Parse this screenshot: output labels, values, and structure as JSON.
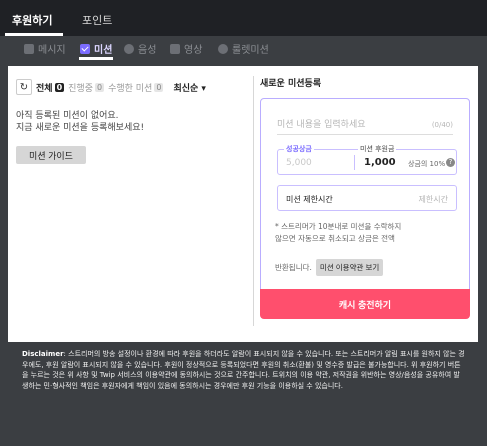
{
  "top_tabs": [
    {
      "label": "후원하기"
    },
    {
      "label": "포인트"
    }
  ],
  "sub_tabs": [
    {
      "label": "메시지",
      "icon": "message-icon"
    },
    {
      "label": "미션",
      "icon": "check-icon"
    },
    {
      "label": "음성",
      "icon": "voice-icon"
    },
    {
      "label": "영상",
      "icon": "video-icon"
    },
    {
      "label": "룰렛미션",
      "icon": "roulette-icon"
    }
  ],
  "left": {
    "filters": [
      {
        "label": "전체",
        "count": "0"
      },
      {
        "label": "진행중",
        "count": "0"
      },
      {
        "label": "수행한 미션",
        "count": "0"
      }
    ],
    "sort_label": "최신순",
    "empty_line1": "아직 등록된 미션이 없어요.",
    "empty_line2": "지금 새로운 미션을 등록해보세요!",
    "guide_button": "미션 가이드"
  },
  "right": {
    "title": "새로운 미션등록",
    "mission_placeholder": "미션 내용을 입력하세요",
    "char_count": "(0/40)",
    "success_label": "성공상금",
    "success_value": "5,000",
    "fee_label": "미션 후원금",
    "fee_value": "1,000",
    "fee_pct": "상금의 10%",
    "limit_label": "미션 제한시간",
    "limit_placeholder": "제한시간",
    "note_line1": "* 스트리머가 10분내로 미션을 수락하지",
    "note_line2": "않으면 자동으로 취소되고 상금은 전액",
    "refund_text": "반환됩니다.",
    "terms_button": "미션 이용약관 보기",
    "charge_button": "캐시 충전하기"
  },
  "disclaimer": {
    "bold": "Disclaimer",
    "text": ": 스트리머의 방송 설정이나 환경에 따라 후원을 하더라도 알람이 표시되지 않을 수 있습니다. 또는 스트리머가 알림 표시를 원하지 않는 경우에도, 후원 알람이 표시되지 않을 수 있습니다. 후원이 정상적으로 등록되었다면 후원의 취소(환불) 및 영수증 발급은 불가능합니다. 위 후원하기 버튼을 누르는 것은 위 사항 및 Twip 서비스의 이용약관에 동의하시는 것으로 간주합니다. 트위치의 이용 약관, 저작권을 위반하는 영상/음성을 공유하여 발생하는 민·형사적인 책임은 후원자에게 책임이 있음에 동의하시는 경우에만 후원 기능을 이용하실 수 있습니다."
  },
  "colors": {
    "accent": "#7b6cff",
    "charge": "#ff4f6d",
    "background": "#3b3e42"
  }
}
